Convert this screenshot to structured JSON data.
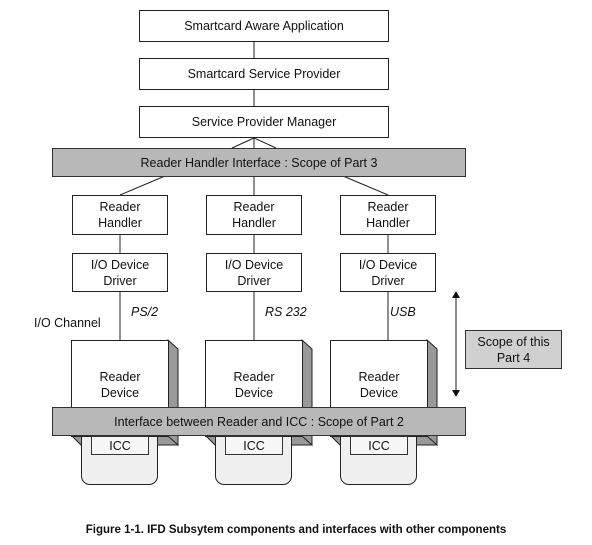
{
  "figure": {
    "caption": "Figure 1-1. IFD Subsytem components and interfaces with other components"
  },
  "stack": {
    "application": "Smartcard Aware Application",
    "service_provider": "Smartcard Service Provider",
    "service_provider_manager": "Service Provider Manager"
  },
  "interfaces": {
    "reader_handler_interface": "Reader Handler Interface : Scope of Part 3",
    "reader_icc_interface": "Interface between Reader and ICC : Scope of Part 2"
  },
  "scope_part4": "Scope of this\nPart 4",
  "io_channel_label": "I/O Channel",
  "columns": [
    {
      "reader_handler": "Reader\nHandler",
      "io_driver": "I/O Device\nDriver",
      "channel": "PS/2",
      "reader_device": "Reader\nDevice",
      "icc": "ICC"
    },
    {
      "reader_handler": "Reader\nHandler",
      "io_driver": "I/O Device\nDriver",
      "channel": "RS 232",
      "reader_device": "Reader\nDevice",
      "icc": "ICC"
    },
    {
      "reader_handler": "Reader\nHandler",
      "io_driver": "I/O Device\nDriver",
      "channel": "USB",
      "reader_device": "Reader\nDevice",
      "icc": "ICC"
    }
  ],
  "colors": {
    "band_fill": "#b8b8b8",
    "scope_fill": "#d0d0d0",
    "side_shade": "#999999",
    "card_fill": "#f0f0f0"
  }
}
